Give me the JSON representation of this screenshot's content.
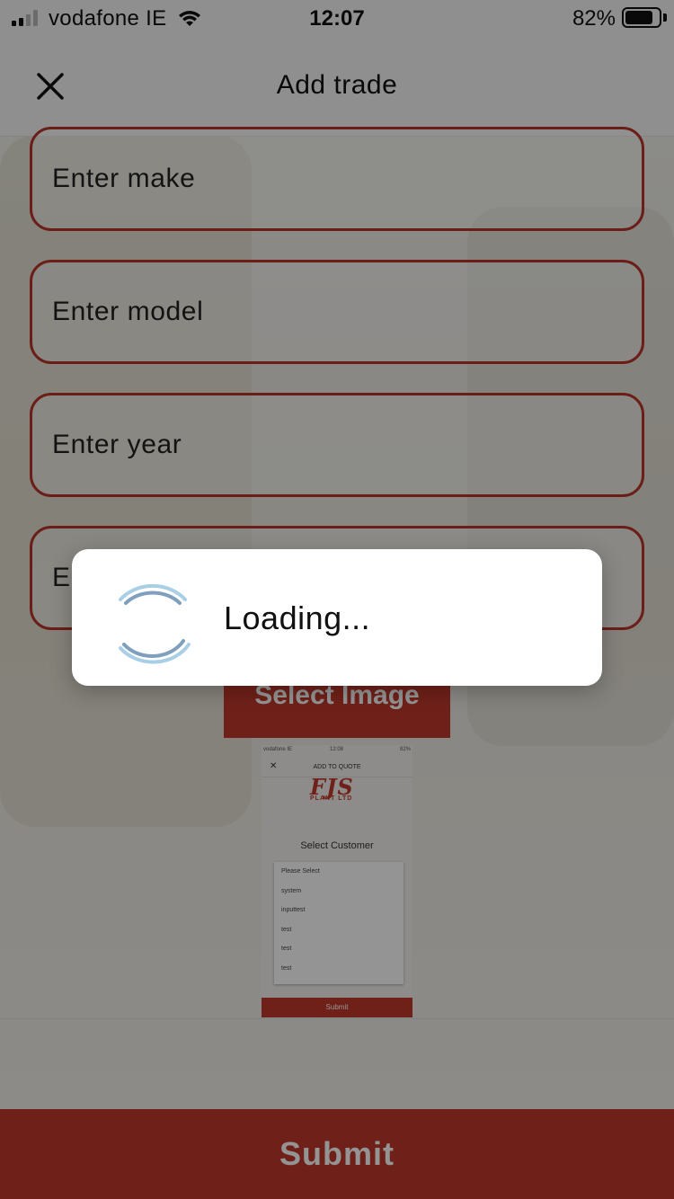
{
  "status_bar": {
    "carrier": "vodafone IE",
    "time": "12:07",
    "battery_percent": "82%",
    "battery_level": 0.82,
    "signal_bars_active": 2,
    "signal_bars_total": 4
  },
  "header": {
    "title": "Add trade",
    "close_icon": "close-icon"
  },
  "form": {
    "make_placeholder": "Enter make",
    "model_placeholder": "Enter model",
    "year_placeholder": "Enter year",
    "fourth_placeholder": "En",
    "select_image_label": "Select Image"
  },
  "preview": {
    "status_carrier": "vodafone IE",
    "status_time": "12:08",
    "status_battery": "82%",
    "title": "ADD TO QUOTE",
    "logo_big": "FJS",
    "logo_small": "PLANT LTD",
    "select_customer": "Select Customer",
    "options": [
      "Please Select",
      "system",
      "inputtest",
      "test",
      "test",
      "test"
    ],
    "submit_label": "Submit"
  },
  "footer": {
    "submit_label": "Submit"
  },
  "loading": {
    "text": "Loading..."
  },
  "colors": {
    "accent": "#c0392b",
    "spinner": "#7aa8d0"
  }
}
